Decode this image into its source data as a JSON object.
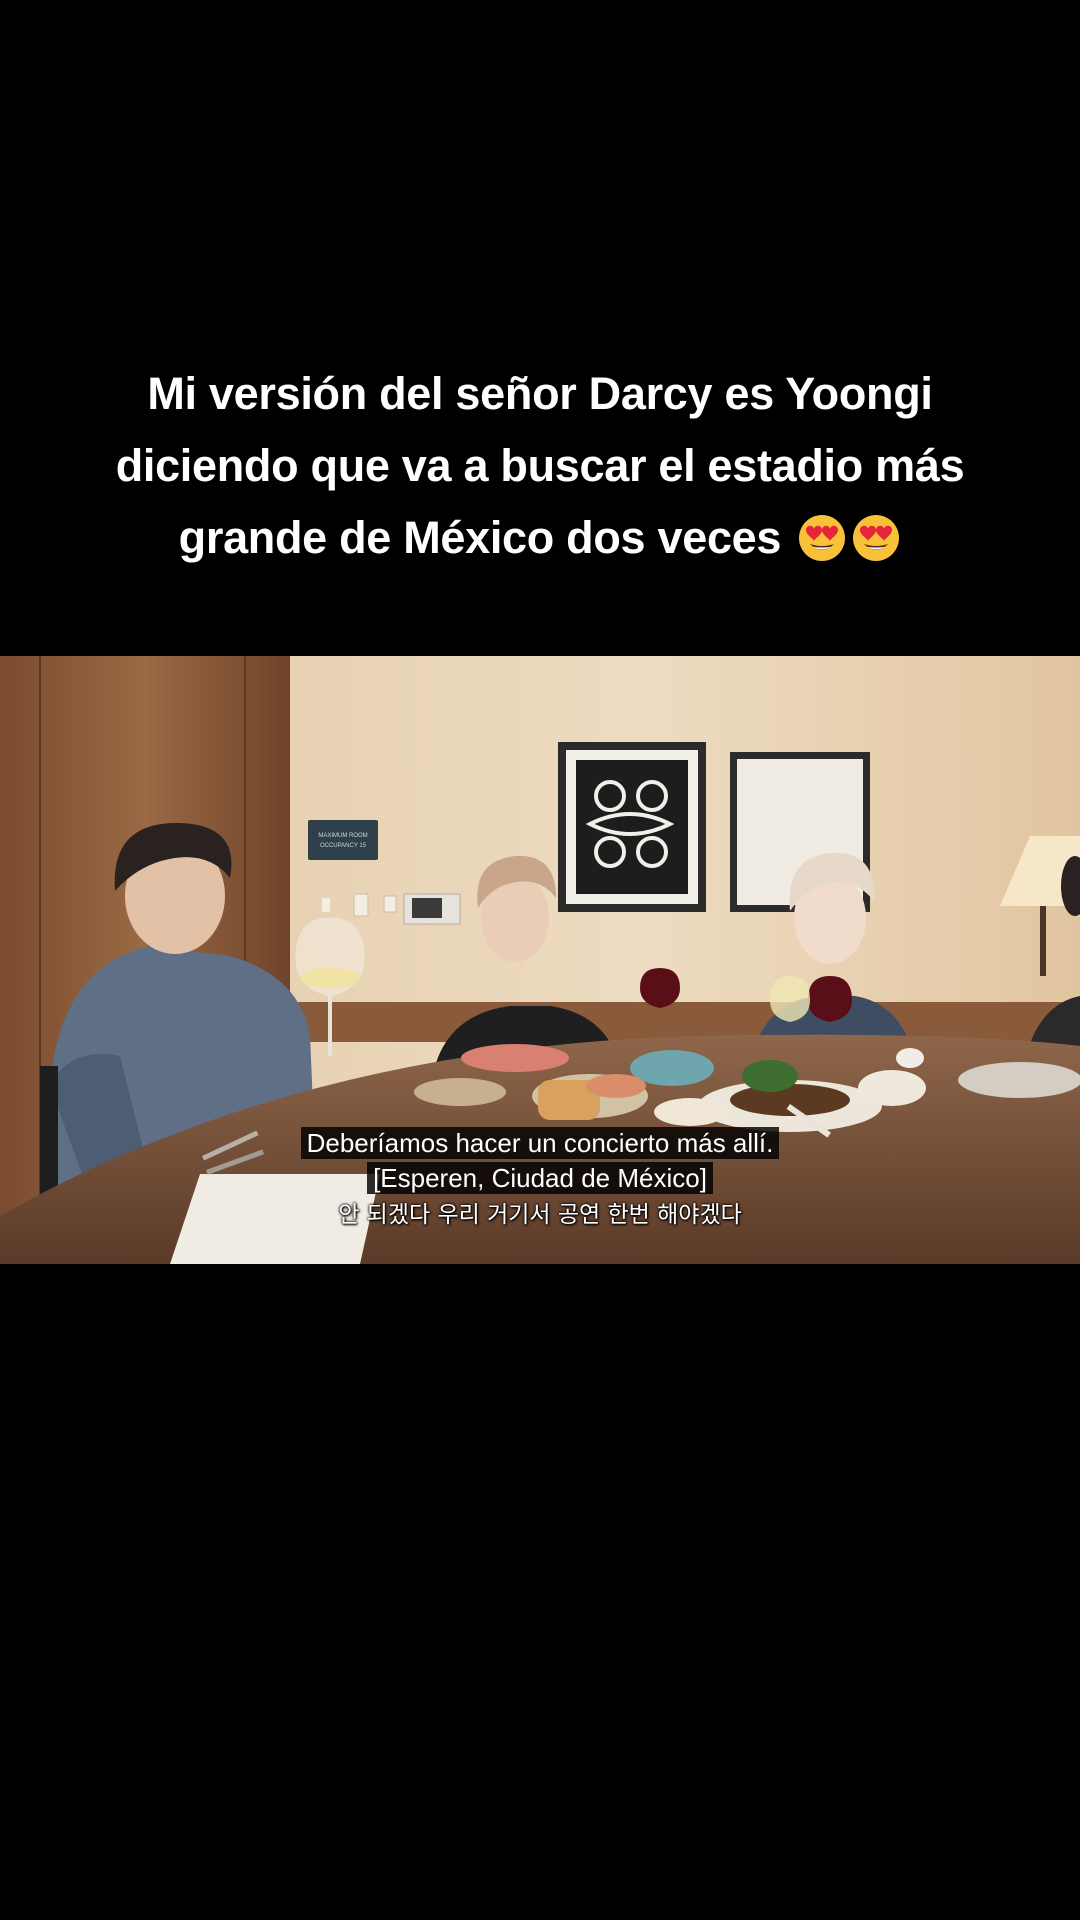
{
  "caption": {
    "line1": "Mi versión del señor Darcy es Yoongi",
    "line2": "diciendo que va a buscar el estadio más",
    "line3": "grande de México dos veces",
    "emojis": [
      "heart-eyes-emoji",
      "heart-eyes-emoji"
    ]
  },
  "video": {
    "subtitle_line1": "Deberíamos hacer un concierto más allí.",
    "subtitle_line2": "[Esperen, Ciudad de México]",
    "subtitle_line3": "안 되겠다 우리 거기서 공연 한번 해야겠다",
    "sign_text_1": "MAXIMUM ROOM",
    "sign_text_2": "OCCUPANCY 15"
  },
  "colors": {
    "background": "#000000",
    "text": "#ffffff",
    "wall": "#e8d3b6",
    "wood": "#8a5a3a",
    "table": "#6e4a34"
  }
}
